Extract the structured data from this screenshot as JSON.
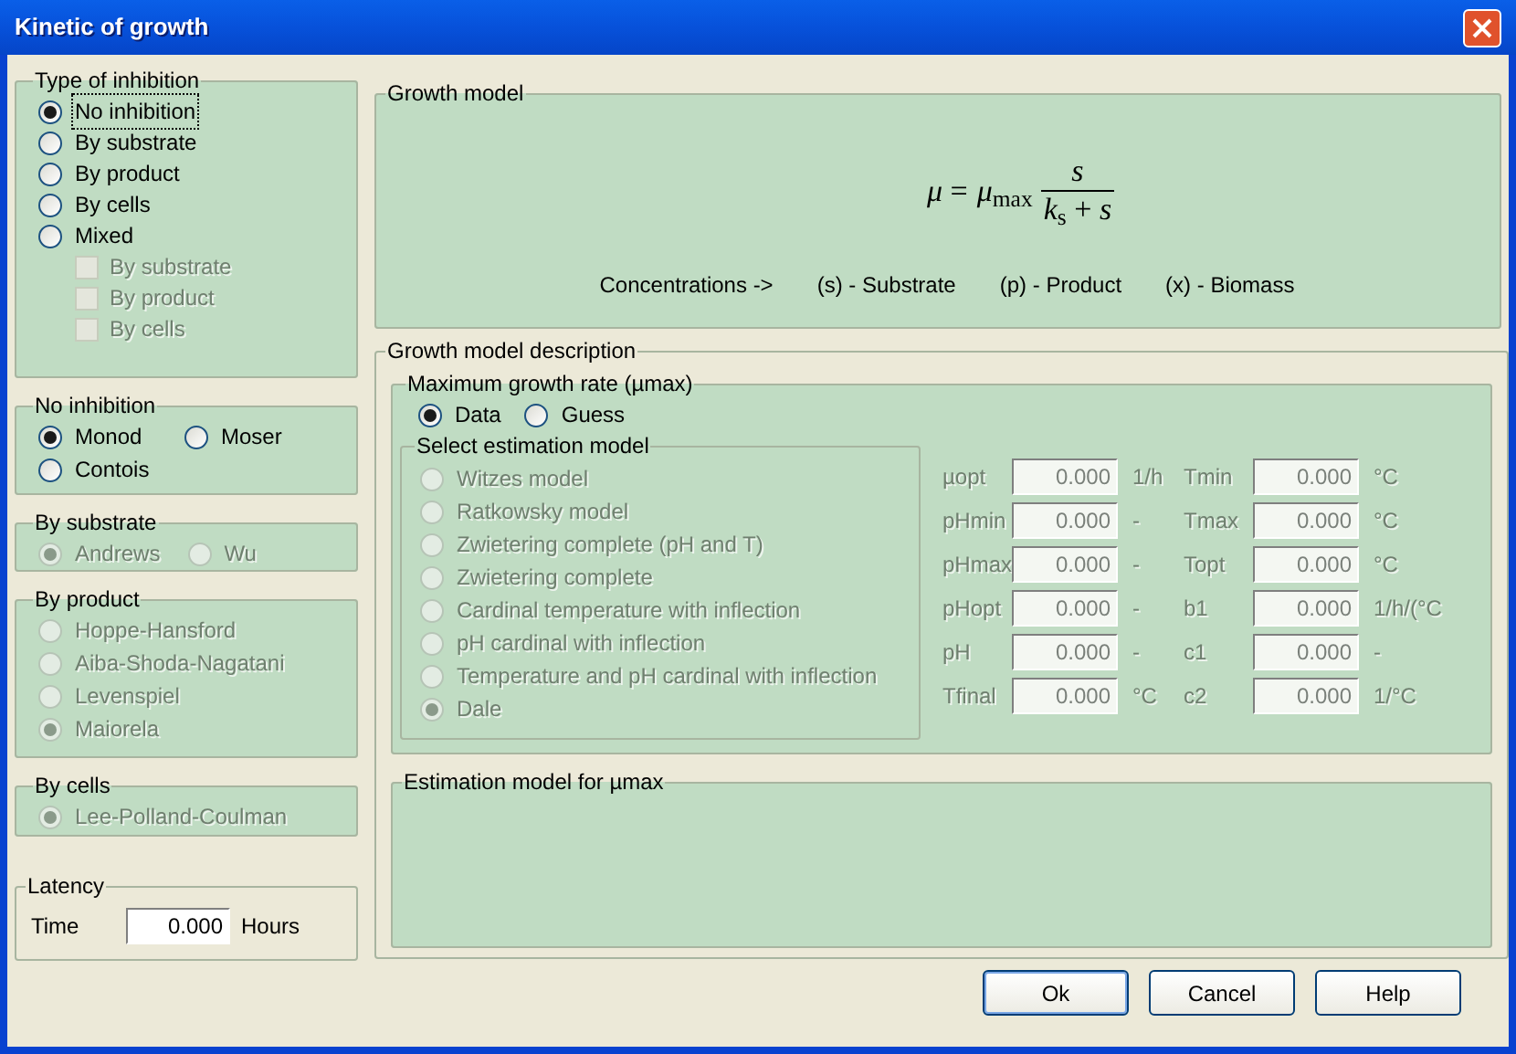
{
  "window": {
    "title": "Kinetic of growth"
  },
  "type_of_inhibition": {
    "title": "Type of inhibition",
    "options": [
      {
        "label": "No inhibition",
        "selected": true,
        "focused": true
      },
      {
        "label": "By substrate",
        "selected": false,
        "focused": false
      },
      {
        "label": "By product",
        "selected": false,
        "focused": false
      },
      {
        "label": "By cells",
        "selected": false,
        "focused": false
      },
      {
        "label": "Mixed",
        "selected": false,
        "focused": false
      }
    ],
    "mixed_options": [
      {
        "label": "By substrate",
        "checked": false,
        "disabled": true
      },
      {
        "label": "By product",
        "checked": false,
        "disabled": true
      },
      {
        "label": "By cells",
        "checked": false,
        "disabled": true
      }
    ]
  },
  "no_inhibition": {
    "title": "No inhibition",
    "options": [
      {
        "label": "Monod",
        "selected": true,
        "disabled": false
      },
      {
        "label": "Moser",
        "selected": false,
        "disabled": false
      },
      {
        "label": "Contois",
        "selected": false,
        "disabled": false
      }
    ]
  },
  "by_substrate": {
    "title": "By substrate",
    "options": [
      {
        "label": "Andrews",
        "selected": true,
        "disabled": true
      },
      {
        "label": "Wu",
        "selected": false,
        "disabled": true
      }
    ]
  },
  "by_product": {
    "title": "By product",
    "options": [
      {
        "label": "Hoppe-Hansford",
        "selected": false,
        "disabled": true
      },
      {
        "label": "Aiba-Shoda-Nagatani",
        "selected": false,
        "disabled": true
      },
      {
        "label": "Levenspiel",
        "selected": false,
        "disabled": true
      },
      {
        "label": "Maiorela",
        "selected": true,
        "disabled": true
      }
    ]
  },
  "by_cells": {
    "title": "By cells",
    "options": [
      {
        "label": "Lee-Polland-Coulman",
        "selected": true,
        "disabled": true
      }
    ]
  },
  "latency": {
    "title": "Latency",
    "label": "Time",
    "value": "0.000",
    "unit": "Hours"
  },
  "growth_model": {
    "title": "Growth model",
    "formula": {
      "lhs": "*μ* =",
      "coefficient": "*μ*$_{max}$",
      "numerator": "*s*",
      "denominator": "*k*$_{s}$ + *s*"
    },
    "legend": [
      "Concentrations ->",
      "(s) - Substrate",
      "(p) - Product",
      "(x) - Biomass"
    ]
  },
  "growth_model_description": {
    "title": "Growth model description",
    "max_growth_rate": {
      "title": "Maximum growth rate (µmax)",
      "sources": [
        {
          "label": "Data",
          "selected": true,
          "disabled": false
        },
        {
          "label": "Guess",
          "selected": false,
          "disabled": false
        }
      ],
      "estimation_model": {
        "title": "Select estimation model",
        "options": [
          {
            "label": "Witzes model",
            "selected": false,
            "disabled": true
          },
          {
            "label": "Ratkowsky model",
            "selected": false,
            "disabled": true
          },
          {
            "label": "Zwietering complete (pH and T)",
            "selected": false,
            "disabled": true
          },
          {
            "label": "Zwietering complete",
            "selected": false,
            "disabled": true
          },
          {
            "label": "Cardinal temperature with inflection",
            "selected": false,
            "disabled": true
          },
          {
            "label": "pH cardinal with inflection",
            "selected": false,
            "disabled": true
          },
          {
            "label": "Temperature and pH cardinal with inflection",
            "selected": false,
            "disabled": true
          },
          {
            "label": "Dale",
            "selected": true,
            "disabled": true
          }
        ]
      },
      "parameters": [
        {
          "label": "µopt",
          "value": "0.000",
          "unit": "1/h",
          "disabled": true
        },
        {
          "label": "Tmin",
          "value": "0.000",
          "unit": "°C",
          "disabled": true
        },
        {
          "label": "pHmin",
          "value": "0.000",
          "unit": "-",
          "disabled": true
        },
        {
          "label": "Tmax",
          "value": "0.000",
          "unit": "°C",
          "disabled": true
        },
        {
          "label": "pHmax",
          "value": "0.000",
          "unit": "-",
          "disabled": true
        },
        {
          "label": "Topt",
          "value": "0.000",
          "unit": "°C",
          "disabled": true
        },
        {
          "label": "pHopt",
          "value": "0.000",
          "unit": "-",
          "disabled": true
        },
        {
          "label": "b1",
          "value": "0.000",
          "unit": "1/h/(°C",
          "disabled": true
        },
        {
          "label": "pH",
          "value": "0.000",
          "unit": "-",
          "disabled": true
        },
        {
          "label": "c1",
          "value": "0.000",
          "unit": "-",
          "disabled": true
        },
        {
          "label": "Tfinal",
          "value": "0.000",
          "unit": "°C",
          "disabled": true
        },
        {
          "label": "c2",
          "value": "0.000",
          "unit": "1/°C",
          "disabled": true
        }
      ]
    },
    "estimation_model_for_umax": {
      "title": "Estimation model for µmax"
    }
  },
  "buttons": [
    {
      "label": "Ok",
      "default": true
    },
    {
      "label": "Cancel",
      "default": false
    },
    {
      "label": "Help",
      "default": false
    }
  ]
}
